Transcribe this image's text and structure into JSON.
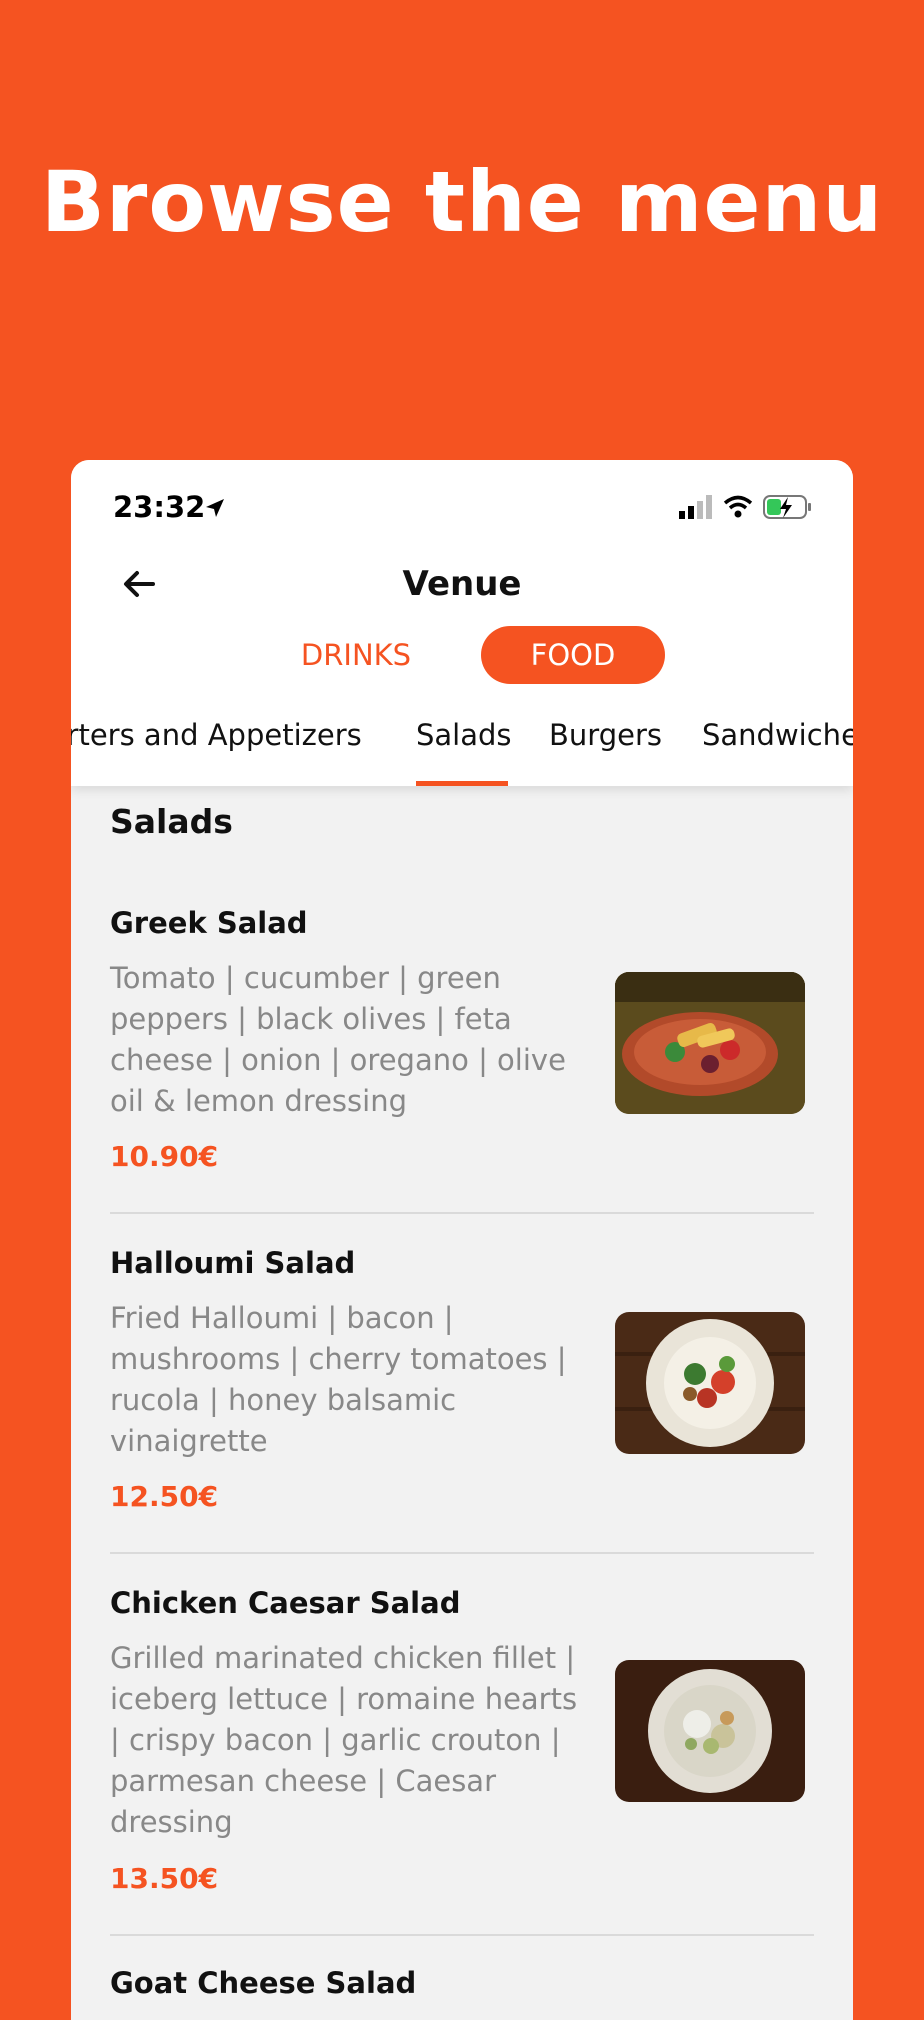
{
  "headline": "Browse the menu",
  "status": {
    "time": "23:32"
  },
  "nav": {
    "title": "Venue"
  },
  "toggle": {
    "drinks": "DRINKS",
    "food": "FOOD"
  },
  "categories": [
    "Starters and Appetizers",
    "Salads",
    "Burgers",
    "Sandwiches"
  ],
  "section_title": "Salads",
  "items": [
    {
      "name": "Greek Salad",
      "description": "Tomato | cucumber | green peppers | black olives | feta cheese | onion | oregano | olive oil & lemon dressing",
      "price": "10.90€"
    },
    {
      "name": "Halloumi Salad",
      "description": "Fried Halloumi | bacon | mushrooms | cherry tomatoes | rucola | honey balsamic vinaigrette",
      "price": "12.50€"
    },
    {
      "name": "Chicken Caesar Salad",
      "description": "Grilled marinated chicken fillet | iceberg lettuce | romaine hearts | crispy bacon | garlic crouton | parmesan cheese | Caesar dressing",
      "price": "13.50€"
    },
    {
      "name": "Goat Cheese Salad"
    }
  ],
  "colors": {
    "brand": "#F55321",
    "background": "#F2F2F2"
  }
}
